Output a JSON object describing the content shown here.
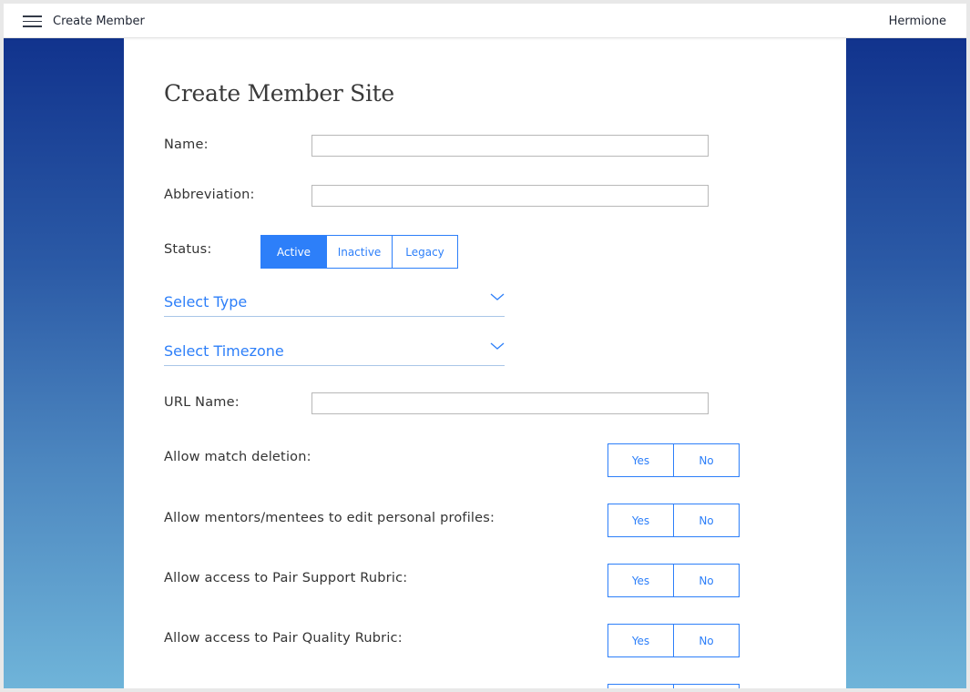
{
  "topbar": {
    "menu_icon": "hamburger-menu-icon",
    "title": "Create Member",
    "user": "Hermione"
  },
  "page": {
    "title": "Create Member Site"
  },
  "form": {
    "name_label": "Name:",
    "name_value": "",
    "abbreviation_label": "Abbreviation:",
    "abbreviation_value": "",
    "status_label": "Status:",
    "status_options": [
      "Active",
      "Inactive",
      "Legacy"
    ],
    "status_selected": "Active",
    "type_select": {
      "label": "Select Type",
      "icon": "chevron-down-icon"
    },
    "timezone_select": {
      "label": "Select Timezone",
      "icon": "chevron-down-icon"
    },
    "url_name_label": "URL Name:",
    "url_name_value": "",
    "toggles": [
      {
        "label": "Allow match deletion:",
        "yes": "Yes",
        "no": "No"
      },
      {
        "label": "Allow mentors/mentees to edit personal profiles:",
        "yes": "Yes",
        "no": "No"
      },
      {
        "label": "Allow access to Pair Support Rubric:",
        "yes": "Yes",
        "no": "No"
      },
      {
        "label": "Allow access to Pair Quality Rubric:",
        "yes": "Yes",
        "no": "No"
      }
    ]
  },
  "colors": {
    "accent": "#2d7ff9",
    "side_gradient_top": "#11338d",
    "side_gradient_bottom": "#6fb4d9"
  }
}
